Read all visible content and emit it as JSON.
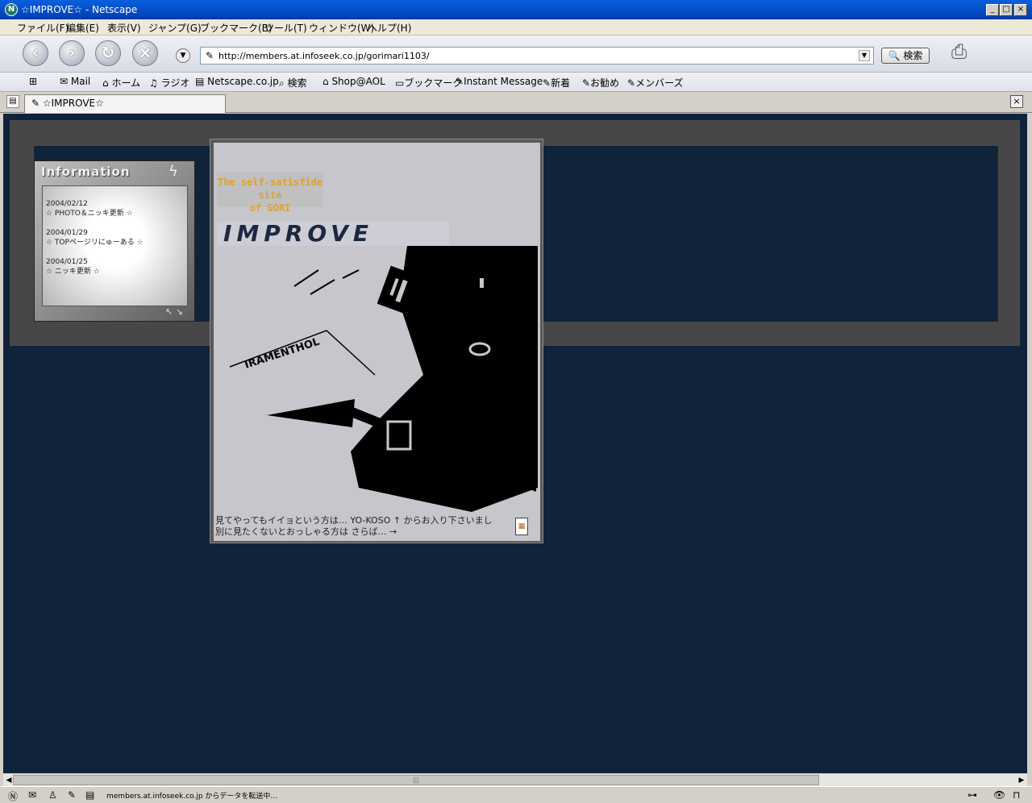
{
  "window": {
    "title": "☆IMPROVE☆ - Netscape",
    "min": "_",
    "max": "□",
    "close": "×"
  },
  "menu": [
    "ファイル(F)",
    "編集(E)",
    "表示(V)",
    "ジャンプ(G)",
    "ブックマーク(B)",
    "ツール(T)",
    "ウィンドウ(W)",
    "ヘルプ(H)"
  ],
  "nav": {
    "back": "‹",
    "forward": "›",
    "reload": "↻",
    "stop": "×",
    "url": "http://members.at.infoseek.co.jp/gorimari1103/",
    "search_label": "🔍 検索",
    "logo": "N"
  },
  "bookmarks": [
    "Mail",
    "ホーム",
    "ラジオ",
    "Netscape.co.jp",
    "検索",
    "Shop@AOL",
    "ブックマーク",
    "Instant Message",
    "新着",
    "お勧め",
    "メンバーズ"
  ],
  "tab": {
    "title": "☆IMPROVE☆",
    "close": "×"
  },
  "page": {
    "info_title": "Information",
    "news": [
      {
        "date": "2004/02/12",
        "text": "☆ PHOTO＆ニッキ更新 ☆"
      },
      {
        "date": "2004/01/29",
        "text": "☆ TOPページリにゅーある ☆"
      },
      {
        "date": "2004/01/25",
        "text": "☆ ニッキ更新 ☆"
      }
    ],
    "tagline_1": "The self-satisfide site",
    "tagline_2": "of GORI",
    "logo_text": "IMPROVE",
    "photo_label": "IRAMENTHOL",
    "caption_1": "見てやってもイイョという方は… YO-KOSO ↑ からお入り下さいまし",
    "caption_2": "別に見たくないとおっしゃる方は さらば… →"
  },
  "status": {
    "text": "members.at.infoseek.co.jp からデータを転送中..."
  }
}
